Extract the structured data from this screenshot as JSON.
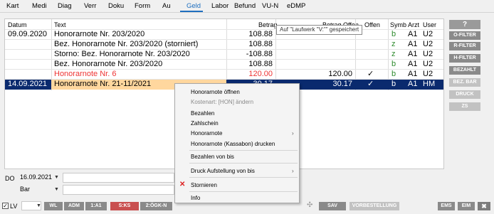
{
  "tabs": [
    "Kart",
    "Medi",
    "Diag",
    "Verr",
    "Doku",
    "Form",
    "Au",
    "Geld",
    "Labor",
    "Befund",
    "VU-N",
    "eDMP"
  ],
  "active_tab": "Geld",
  "table": {
    "headers": {
      "datum": "Datum",
      "text": "Text",
      "betrag": "Betrag",
      "betrag_offen": "Betrag Offen",
      "offen": "Offen",
      "symb": "Symb",
      "arzt": "Arzt",
      "user": "User"
    },
    "rows": [
      {
        "datum": "09.09.2020",
        "text": "Honorarnote Nr. 203/2020",
        "betrag": "108.88",
        "betrag_offen": "",
        "offen": "",
        "symb": "b",
        "arzt": "A1",
        "user": "U2"
      },
      {
        "datum": "",
        "text": "Bez. Honorarnote Nr. 203/2020 (storniert)",
        "betrag": "108.88",
        "betrag_offen": "",
        "offen": "",
        "symb": "z",
        "arzt": "A1",
        "user": "U2"
      },
      {
        "datum": "",
        "text": "Storno: Bez. Honorarnote Nr. 203/2020",
        "betrag": "-108.88",
        "betrag_offen": "",
        "offen": "",
        "symb": "z",
        "arzt": "A1",
        "user": "U2"
      },
      {
        "datum": "",
        "text": "Bez. Honorarnote Nr. 203/2020",
        "betrag": "108.88",
        "betrag_offen": "",
        "offen": "",
        "symb": "b",
        "arzt": "A1",
        "user": "U2"
      },
      {
        "datum": "",
        "text": "Honorarnote Nr. 6",
        "betrag": "120.00",
        "betrag_offen": "120.00",
        "offen": "✓",
        "symb": "b",
        "arzt": "A1",
        "user": "U2"
      },
      {
        "datum": "14.09.2021",
        "text": "Honorarnote Nr. 21-11/2021",
        "betrag": "30.17",
        "betrag_offen": "30.17",
        "offen": "✓",
        "symb": "b",
        "arzt": "A1",
        "user": "HM"
      }
    ]
  },
  "tooltip": "Auf \"Laufwerk \"V:\"\" gespeichert",
  "right_buttons": [
    "?",
    "O-FILTER",
    "R-FILTER",
    "H-FILTER",
    "BEZAHLT",
    "BEZ. BAR",
    "DRUCK",
    "ZS"
  ],
  "context_menu": {
    "open": "Honorarnote öffnen",
    "kostenart": "Kostenart: [HON] ändern",
    "bezahlen": "Bezahlen",
    "zahlschein": "Zahlschein",
    "honorarnote": "Honorarnote",
    "kassabon": "Honorarnote (Kassabon) drucken",
    "bezahlen_von_bis": "Bezahlen von bis",
    "druck_aufstellung": "Druck Aufstellung von bis",
    "stornieren": "Stornieren",
    "info": "Info"
  },
  "form": {
    "do_label": "DO",
    "date": "16.09.2021",
    "payment": "Bar"
  },
  "bottom": {
    "lv": "LV",
    "buttons": [
      "WL",
      "ADM",
      "1:A1",
      "S:KS",
      "2:ÖGK-N",
      "SAV",
      "VORBESTELLUNG",
      "EMS",
      "EIM"
    ],
    "close": "✖"
  },
  "colors": {
    "accent": "#1f6fbf",
    "selected_row": "#0a2a6e",
    "highlight": "#ffd79e",
    "red_button": "#c94f4f"
  }
}
